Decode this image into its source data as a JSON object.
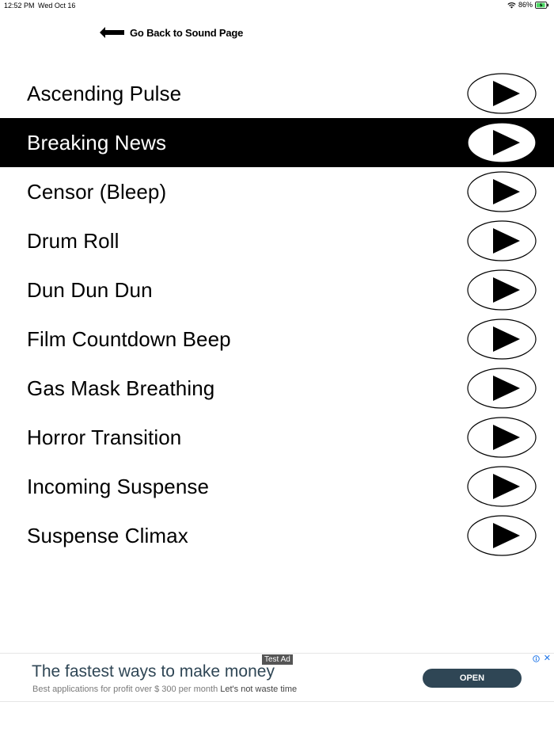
{
  "status_bar": {
    "time": "12:52 PM",
    "date": "Wed Oct 16",
    "battery": "86%",
    "wifi_icon": "wifi-icon",
    "battery_icon": "battery-charging-icon"
  },
  "back_link": {
    "label": "Go Back to Sound Page",
    "icon": "back-arrow-icon"
  },
  "sounds": [
    {
      "name": "Ascending Pulse",
      "active": false
    },
    {
      "name": "Breaking News",
      "active": true
    },
    {
      "name": "Censor (Bleep)",
      "active": false
    },
    {
      "name": "Drum Roll",
      "active": false
    },
    {
      "name": "Dun Dun Dun",
      "active": false
    },
    {
      "name": "Film Countdown Beep",
      "active": false
    },
    {
      "name": "Gas Mask Breathing",
      "active": false
    },
    {
      "name": "Horror Transition",
      "active": false
    },
    {
      "name": "Incoming Suspense",
      "active": false
    },
    {
      "name": "Suspense Climax",
      "active": false
    }
  ],
  "ad": {
    "tag": "Test Ad",
    "headline": "The fastest ways to make money",
    "sub_text": "Best applications for profit over $ 300 per month",
    "sub_text_strong": "Let's not waste time",
    "cta": "OPEN",
    "close": "✕",
    "cta_color": "#2f4655"
  },
  "colors": {
    "active_row_bg": "#000000",
    "active_row_text": "#ffffff"
  }
}
